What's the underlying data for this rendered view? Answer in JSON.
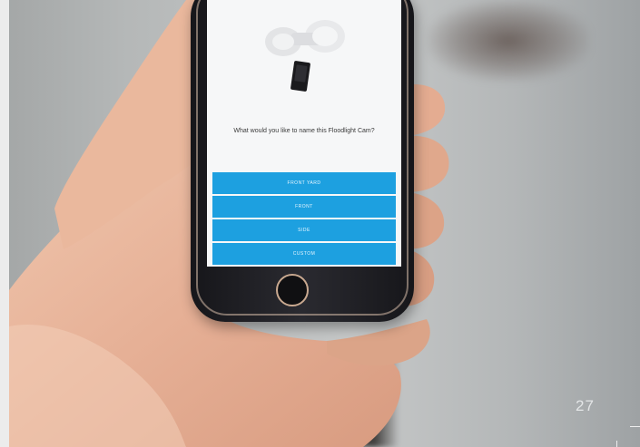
{
  "app": {
    "prompt": "What would you like to name this Floodlight Cam?",
    "options": [
      "FRONT YARD",
      "FRONT",
      "SIDE",
      "CUSTOM"
    ]
  },
  "page_number": "27",
  "colors": {
    "button": "#1da0e0",
    "screen": "#f6f7f8",
    "phone_body": "#1c1c20",
    "phone_trim": "#c9a990",
    "skin": "#e8b9a0",
    "background": "#b9bcbd"
  }
}
